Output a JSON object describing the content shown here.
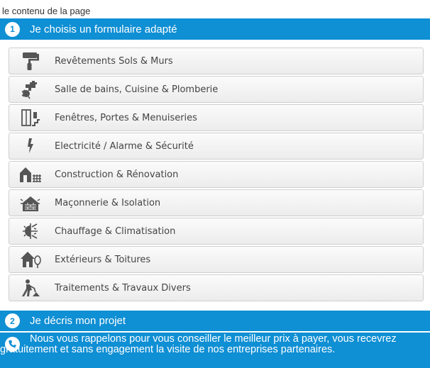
{
  "page_note": "le contenu de la page",
  "step1": {
    "number": "1",
    "title": "Je choisis un formulaire adapté"
  },
  "categories": [
    {
      "icon": "paint-roller-icon",
      "label": "Revêtements Sols & Murs"
    },
    {
      "icon": "faucet-icon",
      "label": "Salle de bains, Cuisine & Plomberie"
    },
    {
      "icon": "door-window-icon",
      "label": "Fenêtres, Portes & Menuiseries"
    },
    {
      "icon": "lightning-icon",
      "label": "Electricité / Alarme & Sécurité"
    },
    {
      "icon": "house-construction-icon",
      "label": "Construction & Rénovation"
    },
    {
      "icon": "brick-wall-icon",
      "label": "Maçonnerie & Isolation"
    },
    {
      "icon": "sun-snowflake-icon",
      "label": "Chauffage & Climatisation"
    },
    {
      "icon": "house-tree-icon",
      "label": "Extérieurs & Toitures"
    },
    {
      "icon": "worker-digging-icon",
      "label": "Traitements & Travaux Divers"
    }
  ],
  "step2": {
    "number": "2",
    "title": "Je décris mon projet"
  },
  "callback_info": {
    "icon": "phone-icon",
    "text": "Nous vous rappelons pour vous conseiller le meilleur prix à payer, vous recevrez gratuitement et sans engagement la visite de nos entreprises partenaires."
  },
  "colors": {
    "accent": "#0f8fd4",
    "item_bg": "#f2f2f2",
    "icon": "#555555"
  }
}
